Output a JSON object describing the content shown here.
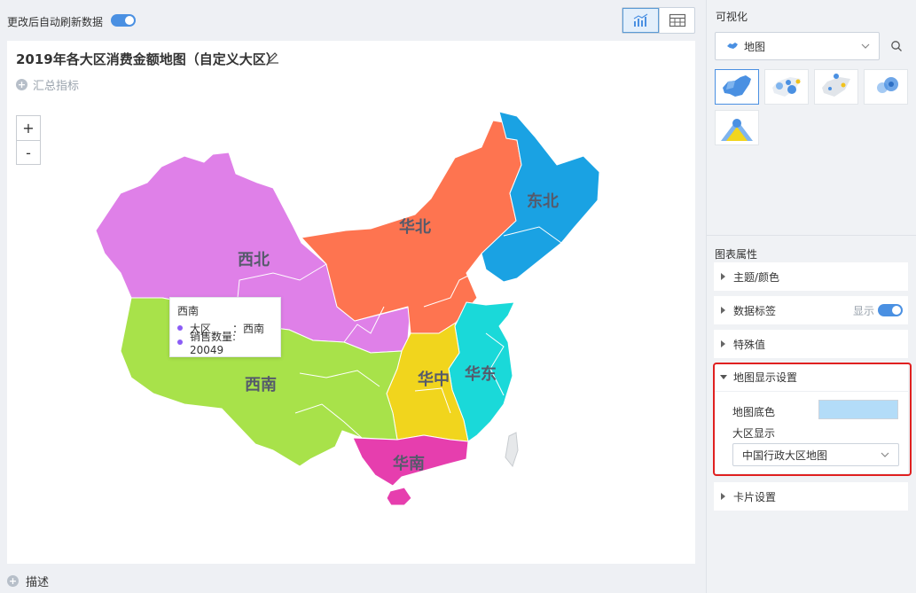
{
  "topbar": {
    "auto_refresh_label": "更改后自动刷新数据",
    "auto_refresh_on": true
  },
  "chart": {
    "title": "2019年各大区消费金额地图（自定义大区）",
    "summary_label": "汇总指标",
    "zoom_in": "+",
    "zoom_out": "-",
    "regions": [
      {
        "name": "东北",
        "color": "#1aa2e3"
      },
      {
        "name": "华北",
        "color": "#fe7450"
      },
      {
        "name": "西北",
        "color": "#df80e8"
      },
      {
        "name": "西南",
        "color": "#a8e24a"
      },
      {
        "name": "华中",
        "color": "#f1d51d"
      },
      {
        "name": "华东",
        "color": "#1ad9d9"
      },
      {
        "name": "华南",
        "color": "#e63eae"
      }
    ],
    "tooltip": {
      "title": "西南",
      "rows": [
        {
          "label": "大区　　：西南"
        },
        {
          "label": "销售数量: 20049"
        }
      ],
      "dot_color": "#8b5cf6"
    }
  },
  "footer": {
    "describe_label": "描述"
  },
  "right_panel": {
    "title": "可视化",
    "chart_type": "地图",
    "thumbnails": [
      "china-map-thumb",
      "bubble-map-thumb",
      "marker-map-thumb",
      "heat-map-thumb",
      "flow-map-thumb"
    ],
    "props_title": "图表属性",
    "sections": {
      "theme": "主题/颜色",
      "data_labels": "数据标签",
      "data_labels_show": "显示",
      "special_values": "特殊值",
      "map_display": "地图显示设置",
      "card": "卡片设置"
    },
    "map_settings": {
      "base_color_label": "地图底色",
      "base_color": "#b3dcf8",
      "region_label": "大区显示",
      "region_value": "中国行政大区地图"
    }
  }
}
